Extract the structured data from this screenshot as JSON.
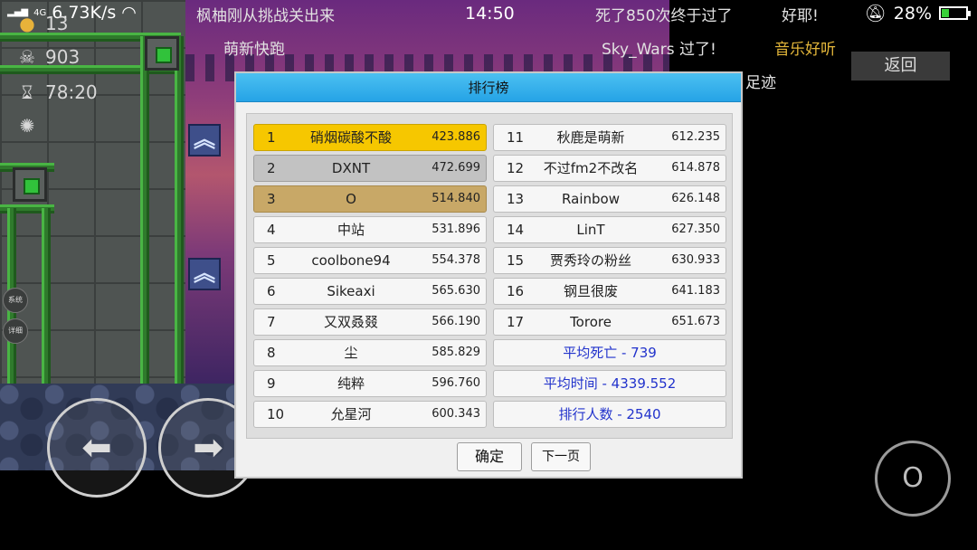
{
  "status_bar": {
    "network": "4G",
    "speed": "6.73K/s",
    "time": "14:50",
    "battery": "28%"
  },
  "hud": {
    "coins": "13",
    "deaths": "903",
    "elapsed": "78:20"
  },
  "side_buttons": [
    "系统",
    "详细"
  ],
  "danmaku": [
    {
      "text": "枫柚刚从挑战关出来"
    },
    {
      "text": "萌新快跑"
    },
    {
      "text": "死了850次终于过了"
    },
    {
      "text": "好耶!"
    },
    {
      "text": "Sky_Wars 过了!"
    },
    {
      "text": "音乐好听",
      "color": "#e3b63a"
    },
    {
      "text": "足迹"
    }
  ],
  "back_button": "返回",
  "dialog": {
    "title": "排行榜",
    "left_column": [
      {
        "rank": "1",
        "name": "硝烟碳酸不酸",
        "score": "423.886"
      },
      {
        "rank": "2",
        "name": "DXNT",
        "score": "472.699"
      },
      {
        "rank": "3",
        "name": "O",
        "score": "514.840"
      },
      {
        "rank": "4",
        "name": "中站",
        "score": "531.896"
      },
      {
        "rank": "5",
        "name": "coolbone94",
        "score": "554.378"
      },
      {
        "rank": "6",
        "name": "Sikeaxi",
        "score": "565.630"
      },
      {
        "rank": "7",
        "name": "又双叒叕",
        "score": "566.190"
      },
      {
        "rank": "8",
        "name": "尘",
        "score": "585.829"
      },
      {
        "rank": "9",
        "name": "纯粹",
        "score": "596.760"
      },
      {
        "rank": "10",
        "name": "允星河",
        "score": "600.343"
      }
    ],
    "right_column": [
      {
        "rank": "11",
        "name": "秋鹿是萌新",
        "score": "612.235"
      },
      {
        "rank": "12",
        "name": "不过fm2不改名",
        "score": "614.878"
      },
      {
        "rank": "13",
        "name": "Rainbow",
        "score": "626.148"
      },
      {
        "rank": "14",
        "name": "LinT",
        "score": "627.350"
      },
      {
        "rank": "15",
        "name": "贾秀玲の粉丝",
        "score": "630.933"
      },
      {
        "rank": "16",
        "name": "钢旦很废",
        "score": "641.183"
      },
      {
        "rank": "17",
        "name": "Torore",
        "score": "651.673"
      }
    ],
    "stats": {
      "avg_deaths": "平均死亡 - 739",
      "avg_time": "平均时间 - 4339.552",
      "player_count": "排行人数 - 2540"
    },
    "confirm_button": "确定",
    "next_page_button": "下一页"
  },
  "controls": {
    "jump_button": "O"
  },
  "colors": {
    "title_bar": "#25a3e6",
    "gold": "#f6c700",
    "silver": "#c2c2c2",
    "bronze": "#c8a867",
    "stat_text": "#2233cc"
  }
}
